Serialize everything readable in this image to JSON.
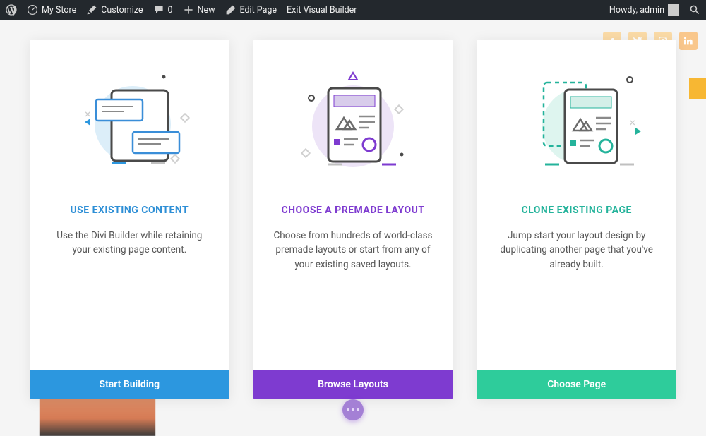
{
  "adminbar": {
    "site": "My Store",
    "customize": "Customize",
    "comments": "0",
    "new": "New",
    "edit": "Edit Page",
    "exit": "Exit Visual Builder",
    "howdy": "Howdy, admin"
  },
  "cards": {
    "existing": {
      "title": "USE EXISTING CONTENT",
      "desc": "Use the Divi Builder while retaining your existing page content.",
      "button": "Start Building"
    },
    "premade": {
      "title": "CHOOSE A PREMADE LAYOUT",
      "desc": "Choose from hundreds of world-class premade layouts or start from any of your existing saved layouts.",
      "button": "Browse Layouts"
    },
    "clone": {
      "title": "CLONE EXISTING PAGE",
      "desc": "Jump start your layout design by duplicating another page that you've already built.",
      "button": "Choose Page"
    }
  }
}
